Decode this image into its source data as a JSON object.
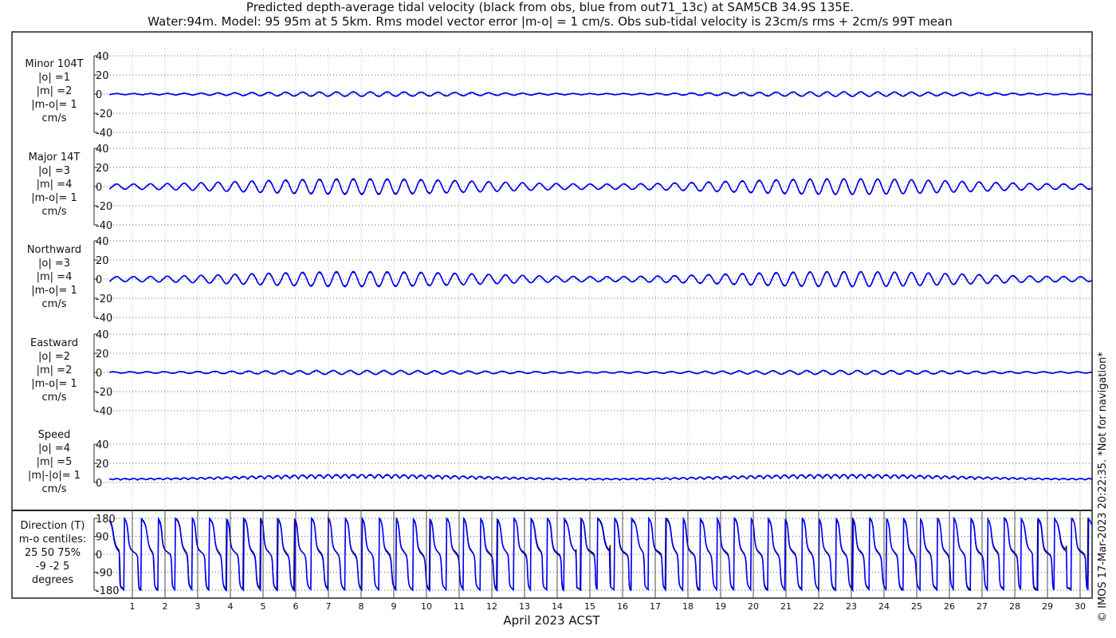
{
  "title_line1": "Predicted depth-average tidal velocity (black from obs, blue from out71_13c) at SAM5CB 34.9S 135E.",
  "title_line2": "Water:94m. Model: 95 95m at 5 5km. Rms model vector error |m-o| = 1 cm/s. Obs sub-tidal velocity is 23cm/s rms + 2cm/s 99T mean",
  "side_note": "© IMOS 17-Mar-2023 20:22:35. *Not for navigation*",
  "colors": {
    "obs": "#000000",
    "model": "#0000ff",
    "grid": "#8888ff"
  },
  "chart_data": {
    "type": "line",
    "xlabel": "April 2023 ACST",
    "x_ticks": [
      "1",
      "2",
      "3",
      "4",
      "5",
      "6",
      "7",
      "8",
      "9",
      "10",
      "11",
      "12",
      "13",
      "14",
      "15",
      "16",
      "17",
      "18",
      "19",
      "20",
      "21",
      "22",
      "23",
      "24",
      "25",
      "26",
      "27",
      "28",
      "29",
      "30"
    ],
    "xlim": [
      0.3,
      30.37
    ],
    "series_names": [
      "obs",
      "model"
    ],
    "panels": [
      {
        "id": "minor",
        "label": [
          "Minor 104T",
          "|o| =1",
          "|m| =2",
          "|m-o|= 1",
          "cm/s"
        ],
        "ylim": [
          -40,
          40
        ],
        "yticks": [
          "40",
          "20",
          "0",
          "-20",
          "-40"
        ],
        "amp": 1.5,
        "spring": 0.6
      },
      {
        "id": "major",
        "label": [
          "Major 14T",
          "|o| =3",
          "|m| =4",
          "|m-o|= 1",
          "cm/s"
        ],
        "ylim": [
          -40,
          40
        ],
        "yticks": [
          "40",
          "20",
          "0",
          "-20",
          "-40"
        ],
        "amp": 5.5,
        "spring": 0.5
      },
      {
        "id": "north",
        "label": [
          "Northward",
          "|o| =3",
          "|m| =4",
          "|m-o|= 1",
          "cm/s"
        ],
        "ylim": [
          -40,
          40
        ],
        "yticks": [
          "40",
          "20",
          "0",
          "-20",
          "-40"
        ],
        "amp": 5.3,
        "spring": 0.5
      },
      {
        "id": "east",
        "label": [
          "Eastward",
          "|o| =2",
          "|m| =2",
          "|m-o|= 1",
          "cm/s"
        ],
        "ylim": [
          -40,
          40
        ],
        "yticks": [
          "40",
          "20",
          "0",
          "-20",
          "-40"
        ],
        "amp": 1.4,
        "spring": 0.5
      },
      {
        "id": "speed",
        "label": [
          "Speed",
          "|o| =4",
          "|m| =5",
          "|m|-|o|= 1",
          "cm/s"
        ],
        "ylim": [
          0,
          40
        ],
        "yticks": [
          "40",
          "20",
          "0"
        ],
        "amp": 5.5,
        "spring": 0.5
      },
      {
        "id": "direction",
        "label": [
          "Direction (T)",
          "m-o centiles:",
          "25  50  75%",
          "-9 -2  5",
          "degrees"
        ],
        "ylim": [
          -180,
          180
        ],
        "yticks": [
          "180",
          "90",
          "0",
          "-90",
          "-180"
        ]
      }
    ]
  }
}
